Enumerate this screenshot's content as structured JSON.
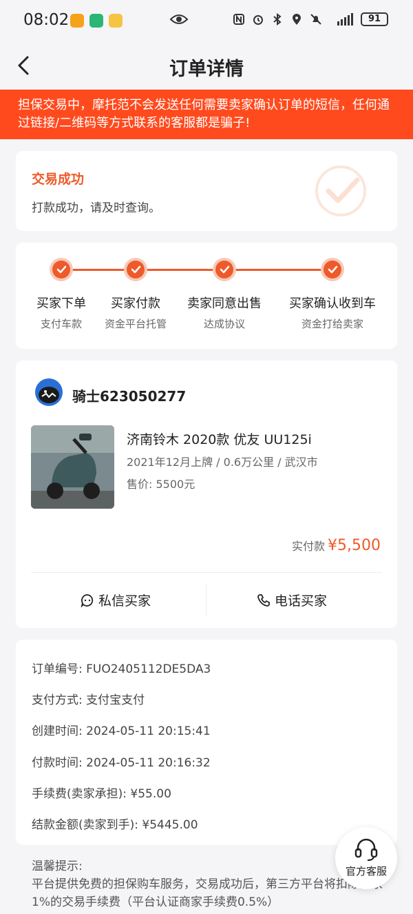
{
  "status_bar": {
    "time": "08:02",
    "battery": "91"
  },
  "header": {
    "title": "订单详情"
  },
  "warning": {
    "text": "担保交易中，摩托范不会发送任何需要卖家确认订单的短信，任何通过链接/二维码等方式联系的客服都是骗子!"
  },
  "status_card": {
    "title": "交易成功",
    "description": "打款成功，请及时查询。"
  },
  "steps": [
    {
      "label": "买家下单",
      "sub": "支付车款"
    },
    {
      "label": "买家付款",
      "sub": "资金平台托管"
    },
    {
      "label": "卖家同意出售",
      "sub": "达成协议"
    },
    {
      "label": "买家确认收到车",
      "sub": "资金打给卖家"
    }
  ],
  "seller": {
    "name": "骑士623050277"
  },
  "product": {
    "title": "济南铃木 2020款 优友 UU125i",
    "meta": "2021年12月上牌 / 0.6万公里 / 武汉市",
    "price": "售价:  5500元",
    "paid_label": "实付款",
    "paid_amount": "¥5,500"
  },
  "actions": {
    "message": "私信买家",
    "call": "电话买家"
  },
  "order_info": [
    "订单编号:  FUO2405112DE5DA3",
    "支付方式:  支付宝支付",
    "创建时间:  2024-05-11 20:15:41",
    "付款时间:  2024-05-11 20:16:32",
    "手续费(卖家承担):  ¥55.00",
    "结款金额(卖家到手):  ¥5445.00"
  ],
  "tips": {
    "title": "温馨提示:",
    "text": "平台提供免费的担保购车服务，交易成功后，第三方平台将扣除卖家1%的交易手续费（平台认证商家手续费0.5%）"
  },
  "customer_service": {
    "label": "官方客服"
  },
  "colors": {
    "accent": "#ee5a2a",
    "warning_bg": "#ff4a1d"
  }
}
